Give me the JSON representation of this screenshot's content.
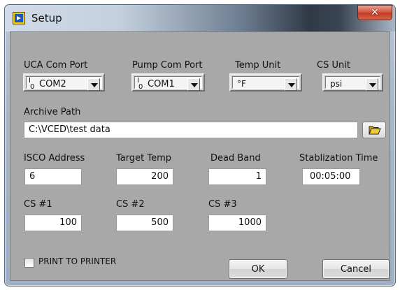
{
  "window": {
    "title": "Setup",
    "close_glyph": "✕"
  },
  "fields": {
    "uca_com_port": {
      "label": "UCA Com Port",
      "value": "COM2"
    },
    "pump_com_port": {
      "label": "Pump Com Port",
      "value": "COM1"
    },
    "temp_unit": {
      "label": "Temp Unit",
      "value": "°F"
    },
    "cs_unit": {
      "label": "CS Unit",
      "value": "psi"
    },
    "archive_path": {
      "label": "Archive Path",
      "value": "C:\\VCED\\test data"
    },
    "isco_address": {
      "label": "ISCO Address",
      "value": "6"
    },
    "target_temp": {
      "label": "Target Temp",
      "value": "200"
    },
    "dead_band": {
      "label": "Dead Band",
      "value": "1"
    },
    "stabilization_time": {
      "label": "Stablization Time",
      "value": "00:05:00"
    },
    "cs1": {
      "label": "CS #1",
      "value": "100"
    },
    "cs2": {
      "label": "CS #2",
      "value": "500"
    },
    "cs3": {
      "label": "CS #3",
      "value": "1000"
    }
  },
  "print_to_printer": {
    "label": "PRINT TO PRINTER",
    "checked": false
  },
  "buttons": {
    "ok": "OK",
    "cancel": "Cancel"
  },
  "io_glyph": {
    "top": "I",
    "bottom": "0"
  },
  "icons": {
    "app": "labview-window-icon",
    "folder": "folder-open-icon",
    "io": "io-ring-icon"
  },
  "colors": {
    "client_bg": "#a8a8a8",
    "close_red": "#c23b25",
    "folder_yellow": "#f0c419"
  }
}
